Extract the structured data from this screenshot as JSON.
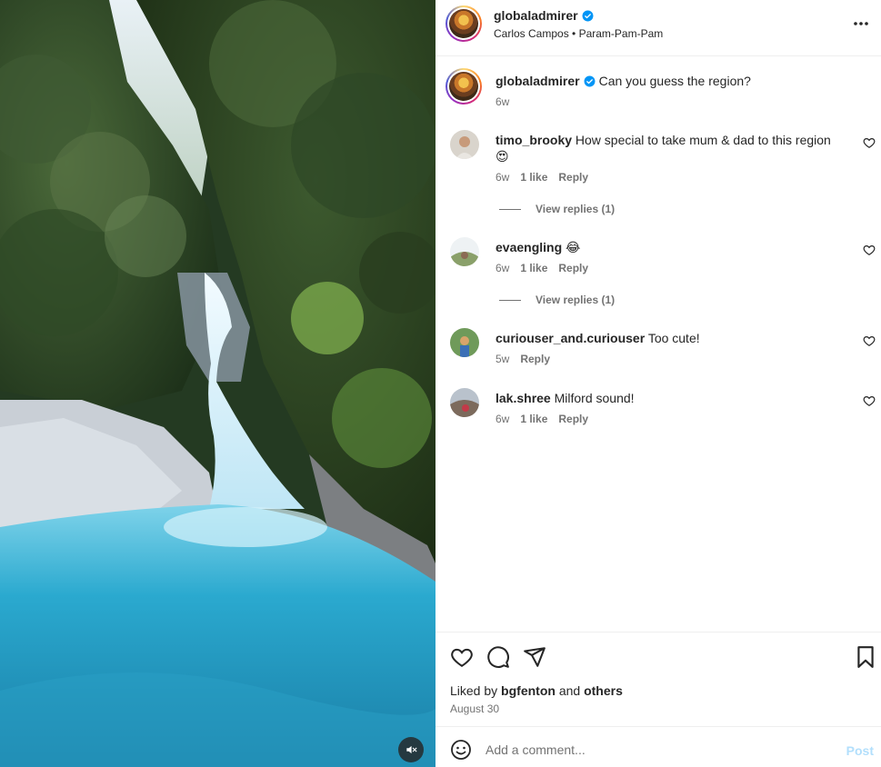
{
  "post": {
    "username": "globaladmirer",
    "verified": true,
    "audio_credit": "Carlos Campos • Param-Pam-Pam",
    "caption_text": "Can you guess the region?",
    "caption_time": "6w",
    "liked_by_prefix": "Liked by",
    "liked_by_user": "bgfenton",
    "liked_by_and": "and",
    "liked_by_others": "others",
    "date": "August 30"
  },
  "comments": [
    {
      "username": "timo_brooky",
      "text": "How special to take mum & dad to this region",
      "emoji": "😍",
      "time": "6w",
      "likes": "1 like",
      "reply_label": "Reply",
      "view_replies": "View replies (1)"
    },
    {
      "username": "evaengling",
      "text": "",
      "emoji": "😂",
      "time": "6w",
      "likes": "1 like",
      "reply_label": "Reply",
      "view_replies": "View replies (1)"
    },
    {
      "username": "curiouser_and.curiouser",
      "text": "Too cute!",
      "emoji": "",
      "time": "5w",
      "likes": "",
      "reply_label": "Reply",
      "view_replies": ""
    },
    {
      "username": "lak.shree",
      "text": "Milford sound!",
      "emoji": "",
      "time": "6w",
      "likes": "1 like",
      "reply_label": "Reply",
      "view_replies": ""
    }
  ],
  "composer": {
    "placeholder": "Add a comment...",
    "post_label": "Post"
  },
  "icons": {
    "header_more": "more-horizontal-icon",
    "like": "heart-icon",
    "comment": "comment-icon",
    "share": "send-icon",
    "save": "bookmark-icon",
    "emoji": "emoji-icon",
    "mute": "speaker-muted-icon",
    "verified": "verified-badge-icon"
  },
  "colors": {
    "verified_blue": "#0095f6",
    "post_disabled": "#b2dffc",
    "secondary_text": "#737373"
  }
}
